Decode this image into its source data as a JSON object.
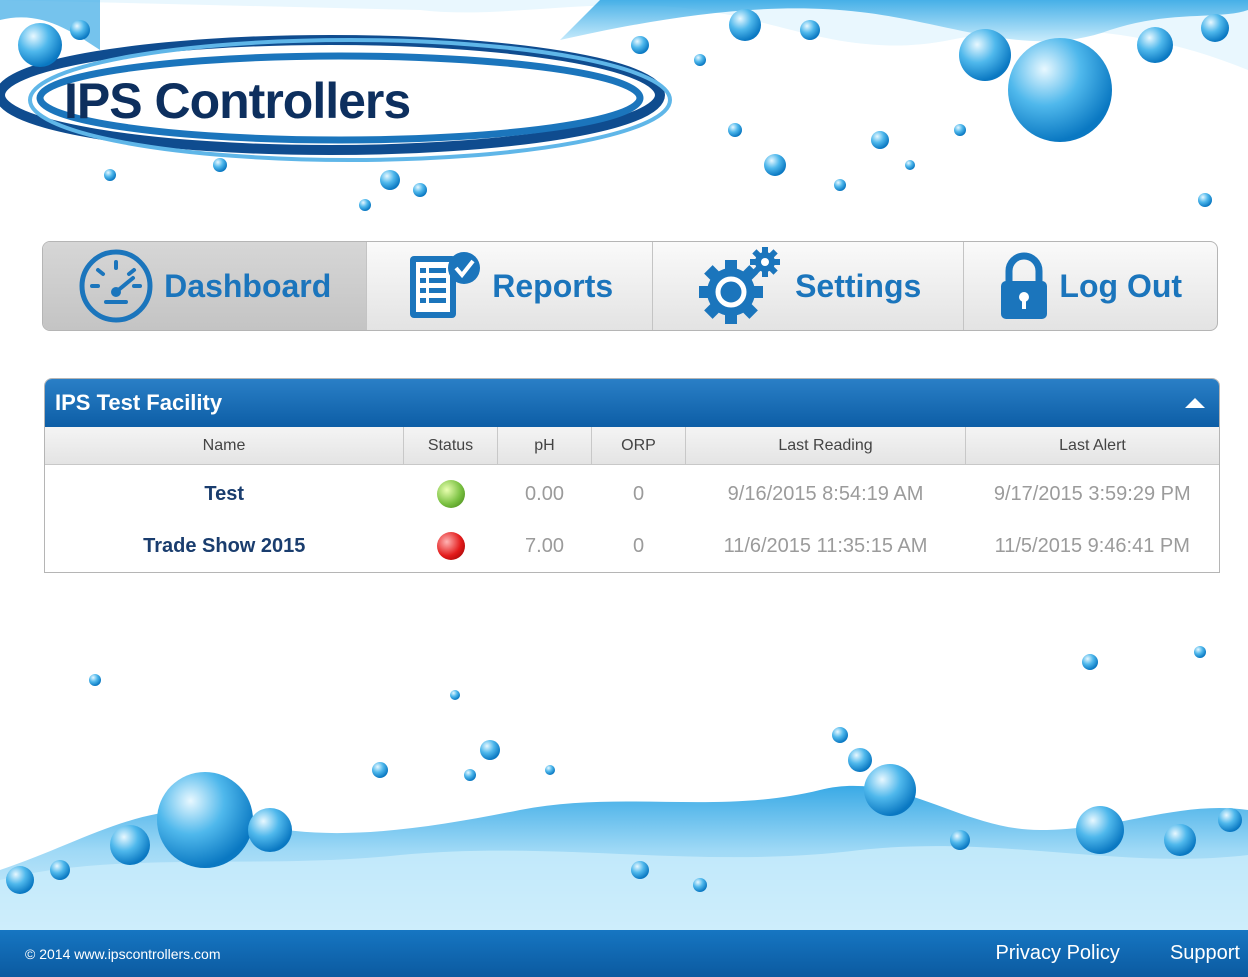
{
  "brand": {
    "logo_text": "IPS Controllers"
  },
  "nav": {
    "items": [
      {
        "label": "Dashboard",
        "icon": "gauge-icon",
        "active": true
      },
      {
        "label": "Reports",
        "icon": "report-check-icon",
        "active": false
      },
      {
        "label": "Settings",
        "icon": "gears-icon",
        "active": false
      },
      {
        "label": "Log Out",
        "icon": "padlock-icon",
        "active": false
      }
    ]
  },
  "facility": {
    "title": "IPS Test Facility",
    "columns": [
      "Name",
      "Status",
      "pH",
      "ORP",
      "Last Reading",
      "Last Alert"
    ],
    "rows": [
      {
        "name": "Test",
        "status": "green",
        "ph": "0.00",
        "orp": "0",
        "last_reading": "9/16/2015 8:54:19 AM",
        "last_alert": "9/17/2015 3:59:29 PM"
      },
      {
        "name": "Trade Show 2015",
        "status": "red",
        "ph": "7.00",
        "orp": "0",
        "last_reading": "11/6/2015 11:35:15 AM",
        "last_alert": "11/5/2015 9:46:41 PM"
      }
    ]
  },
  "footer": {
    "copyright": "© 2014 www.ipscontrollers.com",
    "links": [
      "Privacy Policy",
      "Support"
    ]
  },
  "colors": {
    "brand_blue": "#1b75bc",
    "header_blue": "#0d5ea6",
    "status_green": "#7ac142",
    "status_red": "#e31b1b"
  }
}
